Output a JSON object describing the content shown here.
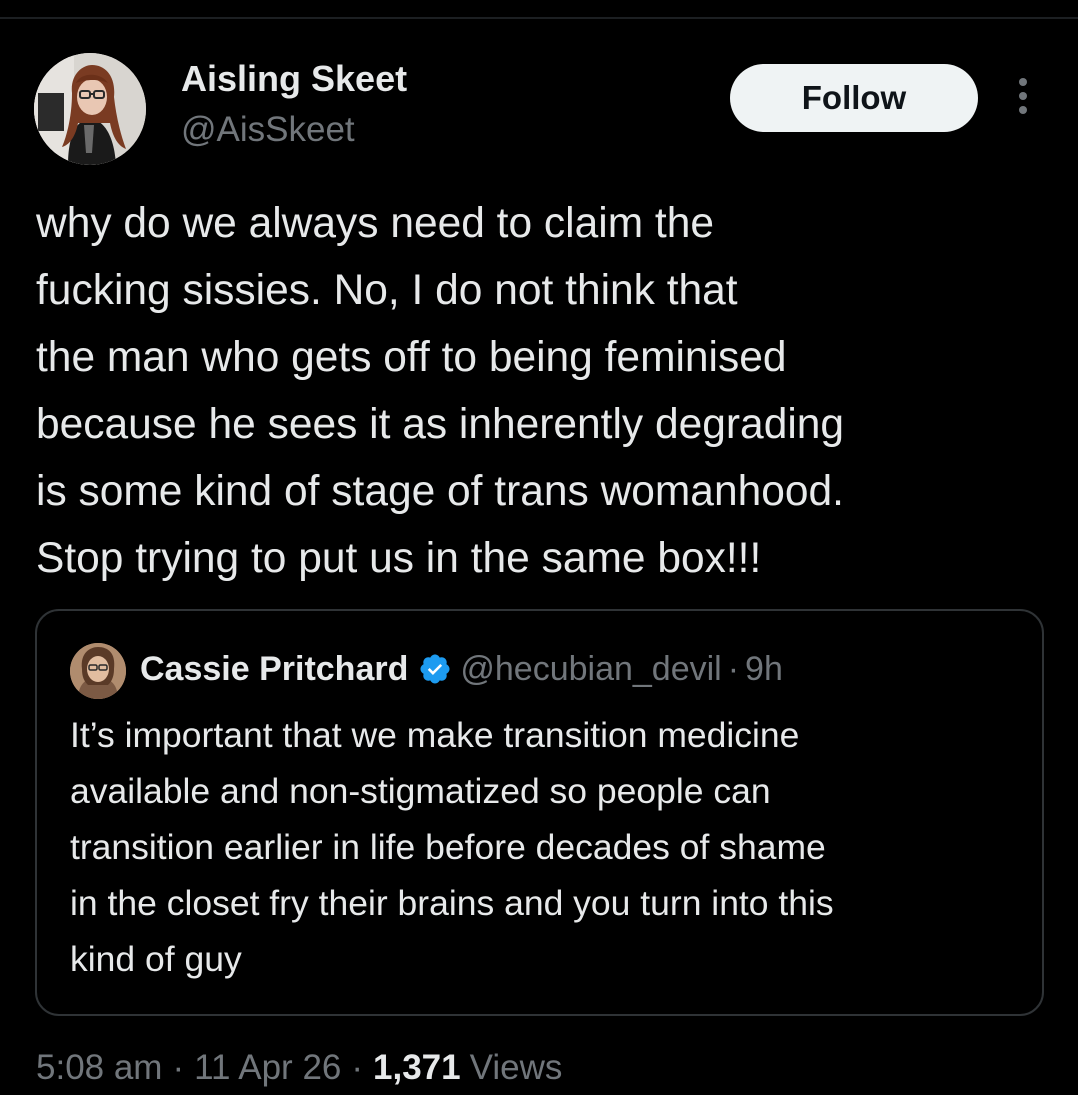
{
  "tweet": {
    "author": {
      "name": "Aisling Skeet",
      "handle": "@AisSkeet"
    },
    "follow_label": "Follow",
    "more_icon": "more-vertical-icon",
    "text": "why do we always need to claim the\nfucking sissies. No, I do not think that\nthe man who gets off to being feminised\nbecause he sees it as inherently degrading\nis some kind of stage of trans womanhood.\nStop trying to put us in the same box!!!",
    "quote": {
      "name": "Cassie Pritchard",
      "verified_icon": "verified-badge-icon",
      "handle": "@hecubian_devil",
      "separator": "·",
      "time": "9h",
      "text": "It’s important that we make transition medicine\navailable and non-stigmatized so people can\ntransition earlier in life before decades of shame\nin the closet fry their brains and you turn into this\nkind of guy"
    },
    "meta": {
      "time": "5:08 am",
      "separator": "·",
      "date": "11 Apr 26",
      "views_count": "1,371",
      "views_label": "Views"
    }
  },
  "colors": {
    "background": "#000000",
    "text_primary": "#e7e9ea",
    "text_secondary": "#71767b",
    "border": "#2f3336",
    "follow_button_bg": "#eff3f4",
    "follow_button_text": "#0f1419",
    "verified_blue": "#1d9bf0"
  }
}
